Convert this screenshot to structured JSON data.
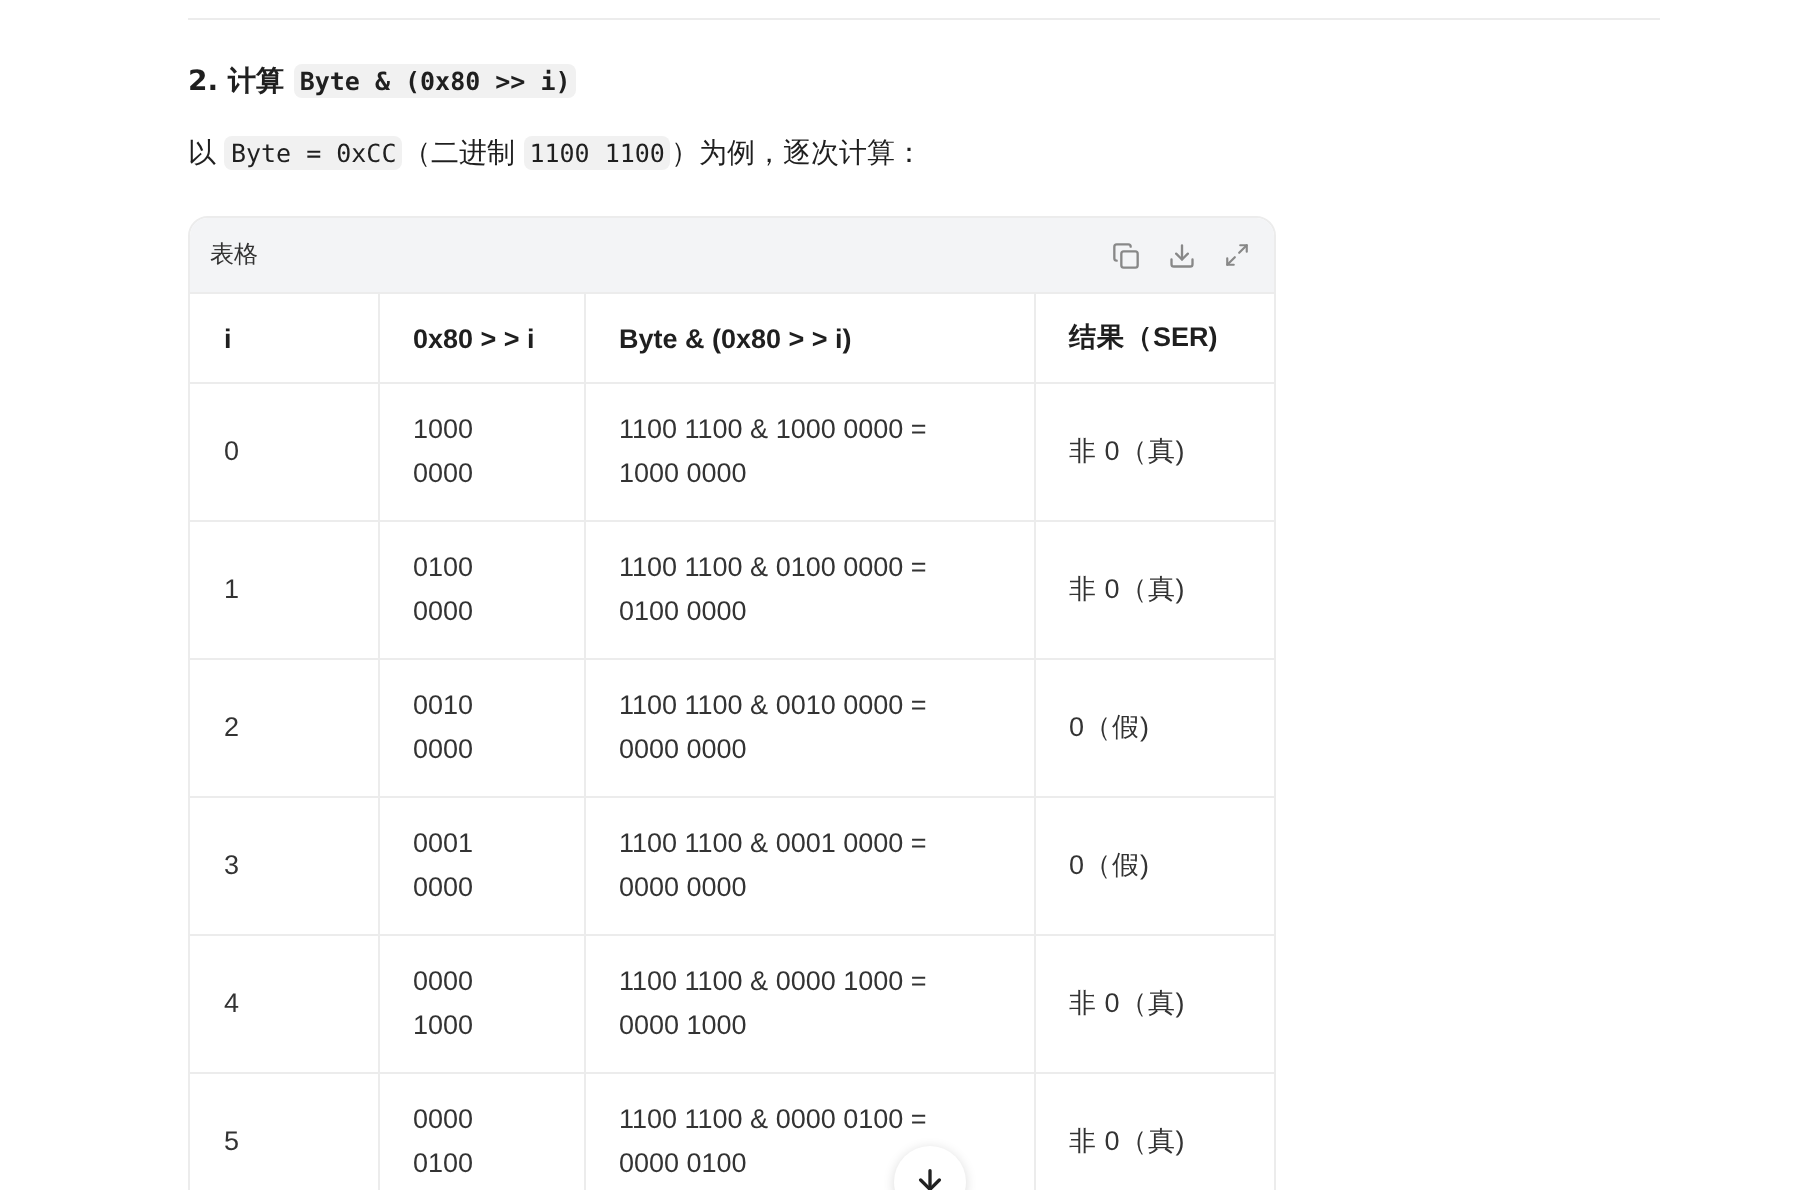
{
  "heading": [
    {
      "kind": "text",
      "text": "2. 计算 "
    },
    {
      "kind": "code",
      "text": "Byte & (0x80 >> i)"
    }
  ],
  "paragraph": [
    {
      "kind": "text",
      "text": "以 "
    },
    {
      "kind": "code",
      "text": "Byte = 0xCC"
    },
    {
      "kind": "text",
      "text": "（二进制 "
    },
    {
      "kind": "code",
      "text": "1100 1100"
    },
    {
      "kind": "text",
      "text": "）为例，逐次计算："
    }
  ],
  "table": {
    "title": "表格",
    "columns": [
      "i",
      "0x80 > > i",
      "Byte & (0x80 > > i)",
      "结果（SER)"
    ],
    "rows": [
      [
        "0",
        "1000 0000",
        "1100 1100 & 1000 0000 = 1000 0000",
        "非 0（真)"
      ],
      [
        "1",
        "0100 0000",
        "1100 1100 & 0100 0000 = 0100 0000",
        "非 0（真)"
      ],
      [
        "2",
        "0010 0000",
        "1100 1100 & 0010 0000 = 0000 0000",
        "0（假)"
      ],
      [
        "3",
        "0001 0000",
        "1100 1100 & 0001 0000 = 0000 0000",
        "0（假)"
      ],
      [
        "4",
        "0000 1000",
        "1100 1100 & 0000 1000 = 0000 1000",
        "非 0（真)"
      ],
      [
        "5",
        "0000 0100",
        "1100 1100 & 0000 0100 = 0000 0100",
        "非 0（真)"
      ]
    ]
  }
}
